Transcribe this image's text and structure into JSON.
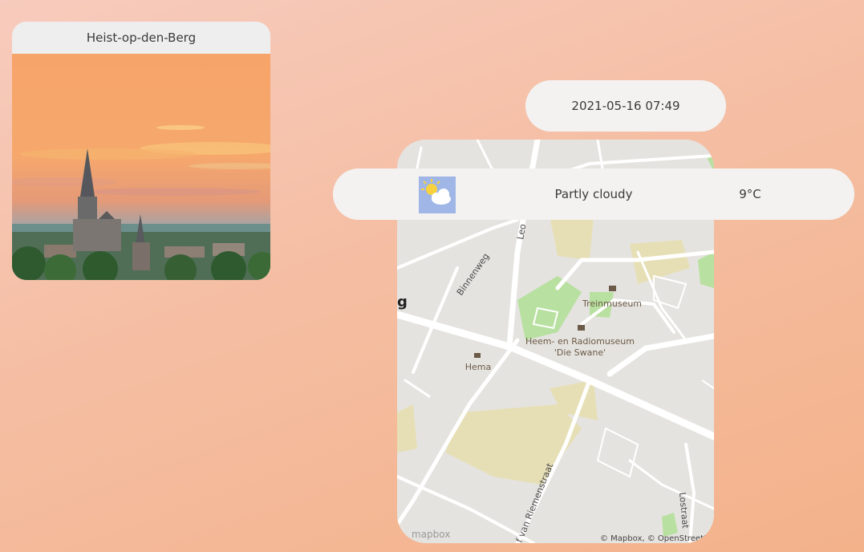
{
  "city": {
    "name": "Heist-op-den-Berg"
  },
  "datetime": "2021-05-16 07:49",
  "weather": {
    "condition": "Partly cloudy",
    "temperature": "9°C",
    "icon": "partly-cloudy-icon"
  },
  "map": {
    "streets": [
      "Binnenweg",
      "Leo",
      "Lostraat",
      "f van Riemenstraat"
    ],
    "pois": [
      "Treinmuseum",
      "Heem- en Radiomuseum",
      "'Die Swane'",
      "Hema"
    ],
    "edge_label": "g",
    "logo": "mapbox",
    "attribution": "© Mapbox, © OpenStreetM"
  }
}
